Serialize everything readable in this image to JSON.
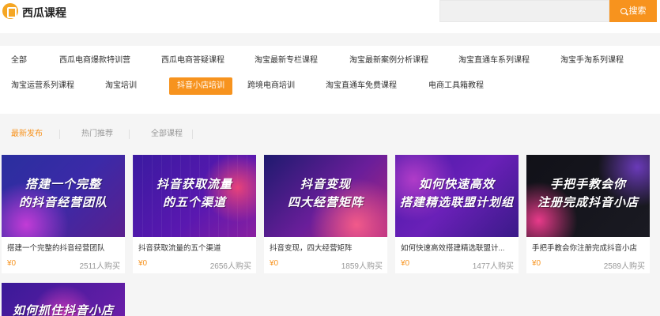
{
  "header": {
    "brand": "西瓜课程",
    "search_button": "搜索"
  },
  "categories": [
    "全部",
    "西瓜电商爆款特训营",
    "西瓜电商答疑课程",
    "淘宝最新专栏课程",
    "淘宝最新案例分析课程",
    "淘宝直通车系列课程",
    "淘宝手淘系列课程",
    "淘宝运营系列课程",
    "淘宝培训",
    "抖音小店培训",
    "跨境电商培训",
    "淘宝直通车免费课程",
    "电商工具箱教程"
  ],
  "active_category": "抖音小店培训",
  "tabs": [
    "最新发布",
    "热门推荐",
    "全部课程"
  ],
  "accent_color": "#f7931e",
  "courses": [
    {
      "thumb_line1": "搭建一个完整",
      "thumb_line2": "的抖音经营团队",
      "title": "搭建一个完整的抖音经营团队",
      "price": "¥0",
      "buyers": "2511人购买"
    },
    {
      "thumb_line1": "抖音获取流量",
      "thumb_line2": "的五个渠道",
      "title": "抖音获取流量的五个渠道",
      "price": "¥0",
      "buyers": "2656人购买"
    },
    {
      "thumb_line1": "抖音变现",
      "thumb_line2": "四大经营矩阵",
      "title": "抖音变现，四大经营矩阵",
      "price": "¥0",
      "buyers": "1859人购买"
    },
    {
      "thumb_line1": "如何快速高效",
      "thumb_line2": "搭建精选联盟计划组",
      "title": "如何快速高效搭建精选联盟计...",
      "price": "¥0",
      "buyers": "1477人购买"
    },
    {
      "thumb_line1": "手把手教会你",
      "thumb_line2": "注册完成抖音小店",
      "title": "手把手教会你注册完成抖音小店",
      "price": "¥0",
      "buyers": "2589人购买"
    },
    {
      "thumb_line1": "如何抓住抖音小店",
      "thumb_line2": "",
      "title": "",
      "price": "",
      "buyers": ""
    }
  ]
}
